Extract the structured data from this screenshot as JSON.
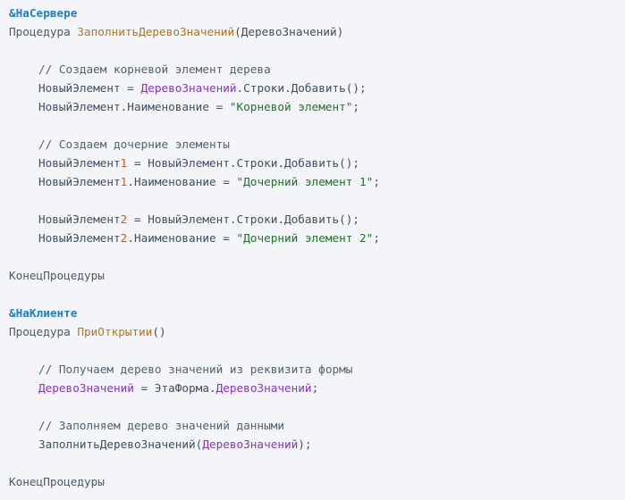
{
  "code": {
    "lines": [
      {
        "indent": 0,
        "tokens": [
          {
            "t": "&НаСервере",
            "k": "directive"
          }
        ]
      },
      {
        "indent": 0,
        "tokens": [
          {
            "t": "Процедура ",
            "k": "keyword"
          },
          {
            "t": "ЗаполнитьДеревоЗначений",
            "k": "func"
          },
          {
            "t": "(ДеревоЗначений)",
            "k": "plain"
          }
        ]
      },
      {
        "indent": 0,
        "tokens": []
      },
      {
        "indent": 1,
        "tokens": [
          {
            "t": "// Создаем корневой элемент дерева",
            "k": "comment"
          }
        ]
      },
      {
        "indent": 1,
        "tokens": [
          {
            "t": "НовыйЭлемент = ",
            "k": "plain"
          },
          {
            "t": "ДеревоЗначений",
            "k": "var"
          },
          {
            "t": ".Строки.Добавить();",
            "k": "plain"
          }
        ]
      },
      {
        "indent": 1,
        "tokens": [
          {
            "t": "НовыйЭлемент.Наименование = ",
            "k": "plain"
          },
          {
            "t": "\"Корневой элемент\"",
            "k": "string"
          },
          {
            "t": ";",
            "k": "plain"
          }
        ]
      },
      {
        "indent": 0,
        "tokens": []
      },
      {
        "indent": 1,
        "tokens": [
          {
            "t": "// Создаем дочерние элементы",
            "k": "comment"
          }
        ]
      },
      {
        "indent": 1,
        "tokens": [
          {
            "t": "НовыйЭлемент",
            "k": "plain"
          },
          {
            "t": "1",
            "k": "num"
          },
          {
            "t": " = НовыйЭлемент.Строки.Добавить();",
            "k": "plain"
          }
        ]
      },
      {
        "indent": 1,
        "tokens": [
          {
            "t": "НовыйЭлемент",
            "k": "plain"
          },
          {
            "t": "1",
            "k": "num"
          },
          {
            "t": ".Наименование = ",
            "k": "plain"
          },
          {
            "t": "\"Дочерний элемент 1\"",
            "k": "string"
          },
          {
            "t": ";",
            "k": "plain"
          }
        ]
      },
      {
        "indent": 0,
        "tokens": []
      },
      {
        "indent": 1,
        "tokens": [
          {
            "t": "НовыйЭлемент",
            "k": "plain"
          },
          {
            "t": "2",
            "k": "num"
          },
          {
            "t": " = НовыйЭлемент.Строки.Добавить();",
            "k": "plain"
          }
        ]
      },
      {
        "indent": 1,
        "tokens": [
          {
            "t": "НовыйЭлемент",
            "k": "plain"
          },
          {
            "t": "2",
            "k": "num"
          },
          {
            "t": ".Наименование = ",
            "k": "plain"
          },
          {
            "t": "\"Дочерний элемент 2\"",
            "k": "string"
          },
          {
            "t": ";",
            "k": "plain"
          }
        ]
      },
      {
        "indent": 0,
        "tokens": []
      },
      {
        "indent": 0,
        "tokens": [
          {
            "t": "КонецПроцедуры",
            "k": "keyword"
          }
        ]
      },
      {
        "indent": 0,
        "tokens": []
      },
      {
        "indent": 0,
        "tokens": [
          {
            "t": "&НаКлиенте",
            "k": "directive"
          }
        ]
      },
      {
        "indent": 0,
        "tokens": [
          {
            "t": "Процедура ",
            "k": "keyword"
          },
          {
            "t": "ПриОткрытии",
            "k": "func"
          },
          {
            "t": "()",
            "k": "plain"
          }
        ]
      },
      {
        "indent": 0,
        "tokens": []
      },
      {
        "indent": 1,
        "tokens": [
          {
            "t": "// Получаем дерево значений из реквизита формы",
            "k": "comment"
          }
        ]
      },
      {
        "indent": 1,
        "tokens": [
          {
            "t": "ДеревоЗначений",
            "k": "var"
          },
          {
            "t": " = ЭтаФорма.",
            "k": "plain"
          },
          {
            "t": "ДеревоЗначений",
            "k": "var"
          },
          {
            "t": ";",
            "k": "plain"
          }
        ]
      },
      {
        "indent": 0,
        "tokens": []
      },
      {
        "indent": 1,
        "tokens": [
          {
            "t": "// Заполняем дерево значений данными",
            "k": "comment"
          }
        ]
      },
      {
        "indent": 1,
        "tokens": [
          {
            "t": "ЗаполнитьДеревоЗначений(",
            "k": "plain"
          },
          {
            "t": "ДеревоЗначений",
            "k": "var"
          },
          {
            "t": ");",
            "k": "plain"
          }
        ]
      },
      {
        "indent": 0,
        "tokens": []
      },
      {
        "indent": 0,
        "tokens": [
          {
            "t": "КонецПроцедуры",
            "k": "keyword"
          }
        ]
      }
    ]
  }
}
